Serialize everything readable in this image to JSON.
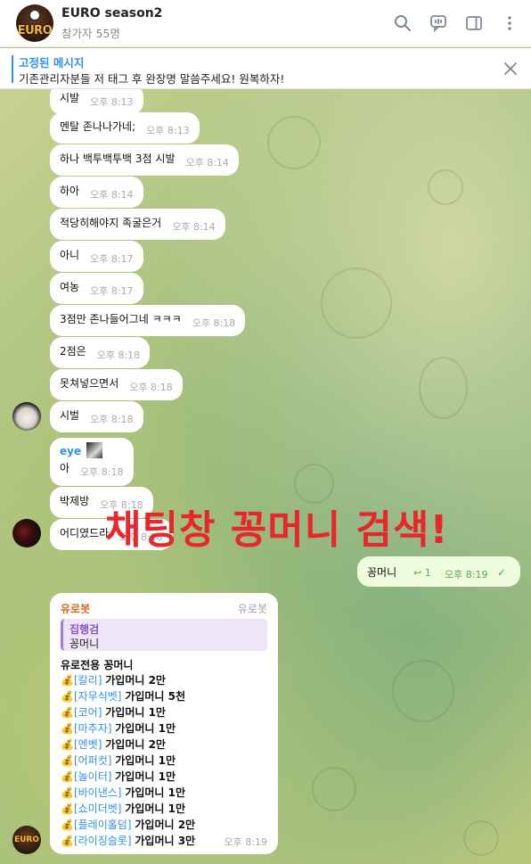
{
  "header": {
    "title": "EURO season2",
    "subtitle": "참가자 55명",
    "logo_text": "EURO",
    "icons": [
      "search-icon",
      "voice-chat-icon",
      "sidebar-toggle-icon",
      "more-vertical-icon"
    ]
  },
  "pinned": {
    "title": "고정된 메시지",
    "text": "기존관리자분들 저 태그 후  완장명 말씀주세요! 원복하자!"
  },
  "messages": [
    {
      "text": "시발",
      "time": "오후 8:13"
    },
    {
      "text": "멘탈 존나나가네;",
      "time": "오후 8:13"
    },
    {
      "text": "하나 백투백투백 3점 시발",
      "time": "오후 8:14"
    },
    {
      "text": "하아",
      "time": "오후 8:14"
    },
    {
      "text": "적당히해야지 족굴은거",
      "time": "오후 8:14"
    },
    {
      "text": "아니",
      "time": "오후 8:17"
    },
    {
      "text": "여농",
      "time": "오후 8:17"
    },
    {
      "text": "3점만 존나들어그네 ㅋㅋㅋ",
      "time": "오후 8:18"
    },
    {
      "text": "2점은",
      "time": "오후 8:18"
    },
    {
      "text": "못쳐넣으면서",
      "time": "오후 8:18"
    },
    {
      "text": "시벌",
      "time": "오후 8:18"
    },
    {
      "sender": "eye",
      "text": "아",
      "time": "오후 8:18"
    },
    {
      "text": "박제방",
      "time": "오후 8:18"
    },
    {
      "text": "어디였드라",
      "time": "오후 8:18"
    }
  ],
  "overlay": "채팅창 꽁머니 검색!",
  "outgoing": {
    "text": "꽁머니",
    "reply_count": "1",
    "time": "오후 8:19"
  },
  "bot": {
    "name": "유로봇",
    "tag": "유로봇",
    "quote_name": "집행검",
    "quote_text": "꽁머니",
    "heading": "유로전용 꽁머니",
    "items": [
      {
        "site": "[칼리]",
        "value": "가입머니 2만"
      },
      {
        "site": "[자무식벳]",
        "value": "가입머니 5천"
      },
      {
        "site": "[코어]",
        "value": "가입머니 1만"
      },
      {
        "site": "[마추자]",
        "value": "가입머니 1만"
      },
      {
        "site": "[엔벳]",
        "value": "가입머니 2만"
      },
      {
        "site": "[어퍼컷]",
        "value": "가입머니 1만"
      },
      {
        "site": "[놀이터]",
        "value": "가입머니 1만"
      },
      {
        "site": "[바이낸스]",
        "value": "가입머니 1만"
      },
      {
        "site": "[쇼미더벳]",
        "value": "가입머니 1만"
      },
      {
        "site": "[플레이홀덤]",
        "value": "가입머니 2만"
      },
      {
        "site": "[라이징슬롯]",
        "value": "가입머니 3만"
      }
    ],
    "time": "오후 8:19"
  },
  "colors": {
    "accent": "#3390ec",
    "overlay": "#e8262c",
    "outgoing_bg": "#effdde",
    "bot_name": "#d2691e"
  }
}
